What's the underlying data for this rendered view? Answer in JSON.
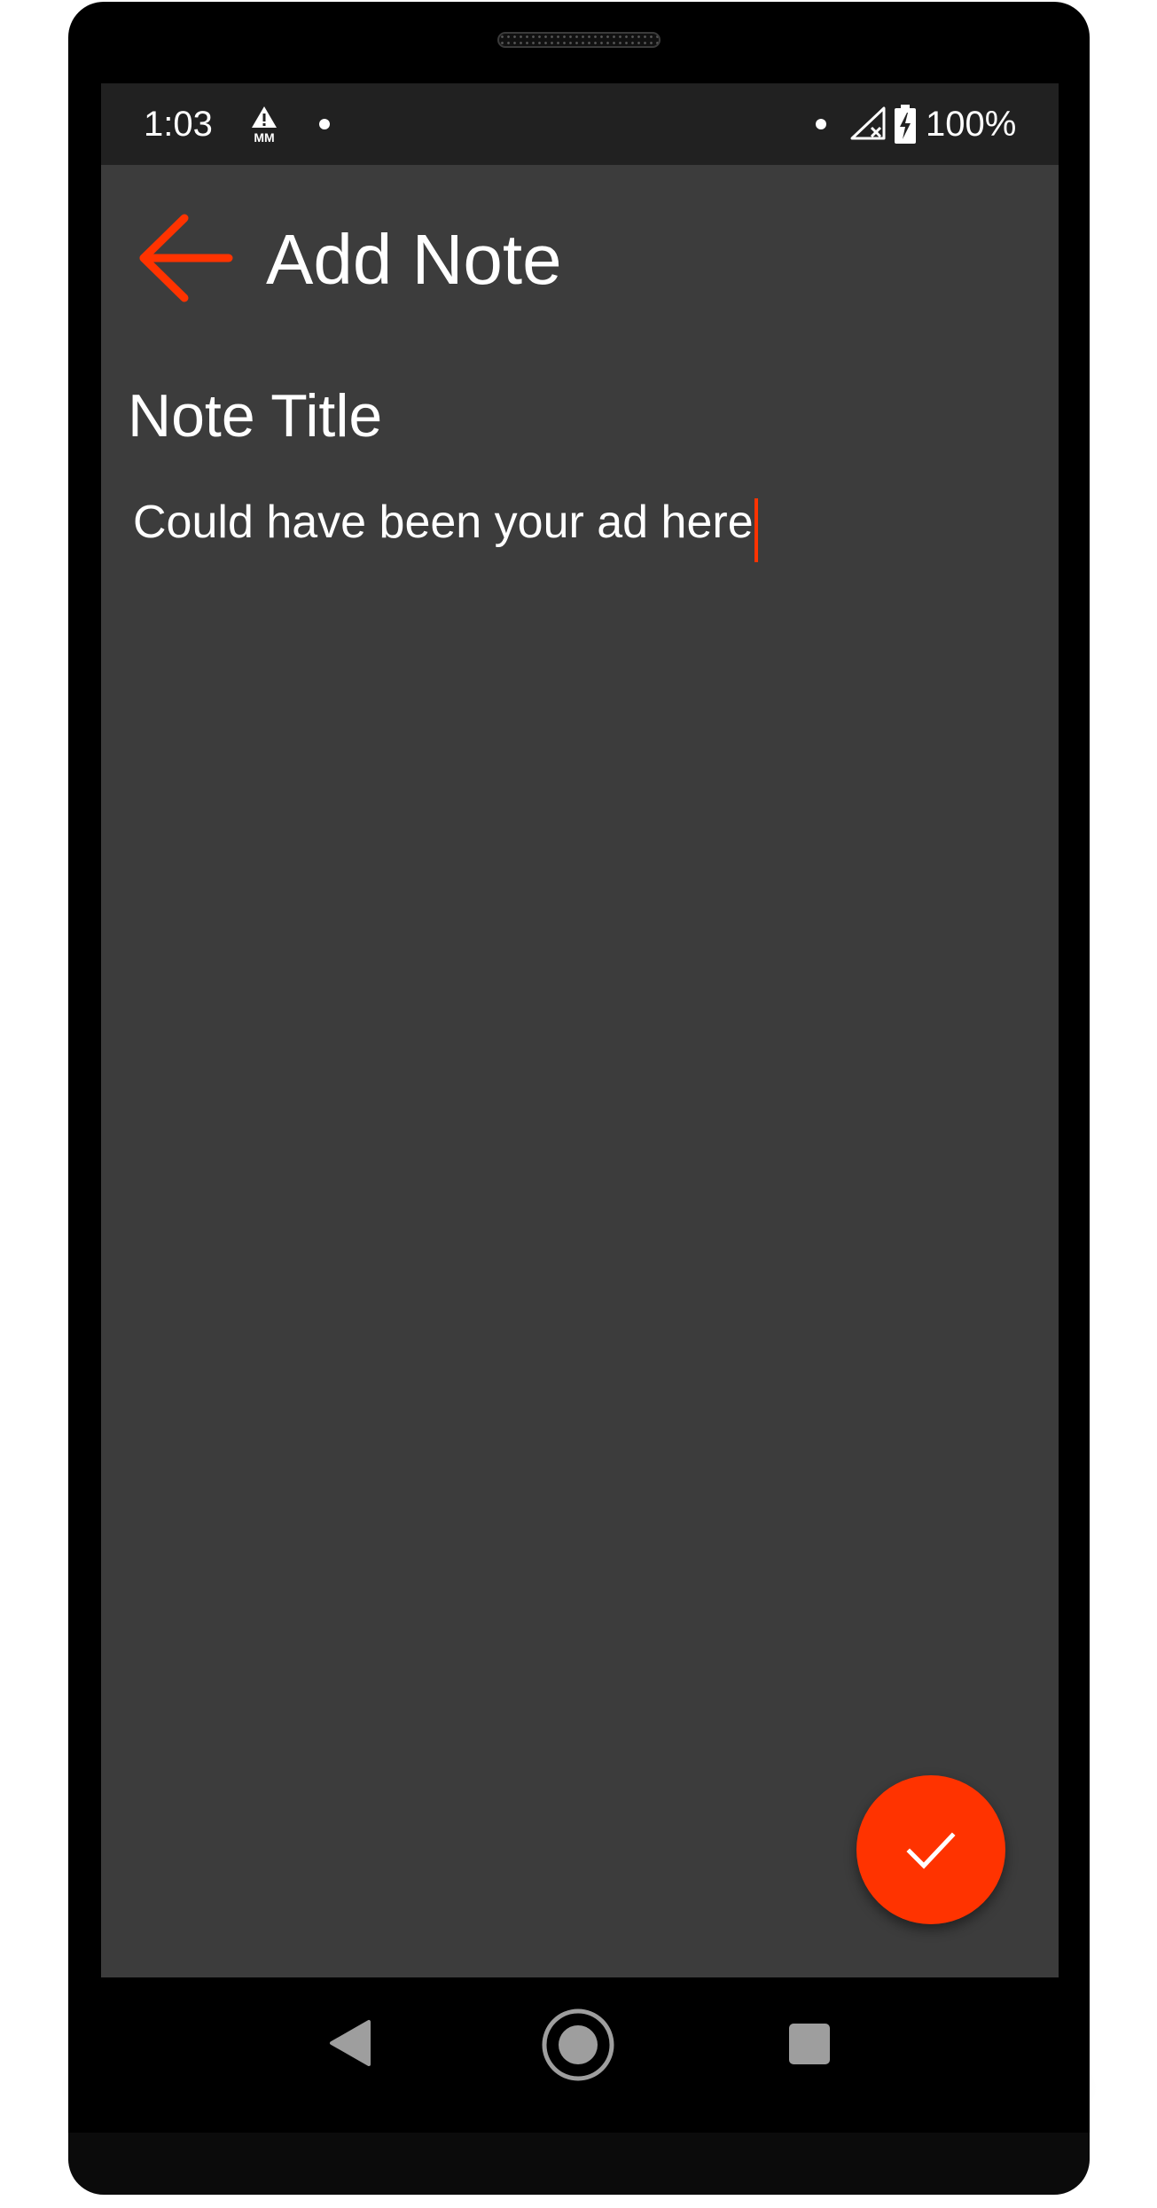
{
  "status_bar": {
    "time": "1:03",
    "battery_text": "100%",
    "icons": [
      "warning-mm-icon",
      "notification-dot-icon",
      "notification-dot-icon",
      "signal-off-icon",
      "battery-charging-icon"
    ]
  },
  "app_bar": {
    "title": "Add Note",
    "back_icon": "arrow-back-icon"
  },
  "note": {
    "title_placeholder": "Note Title",
    "title_value": "",
    "body_value": "Could have been your ad here"
  },
  "fab": {
    "icon": "check-icon"
  },
  "navigation_bar": {
    "icons": [
      "nav-back-icon",
      "nav-home-icon",
      "nav-recents-icon"
    ]
  },
  "colors": {
    "accent": "#ff3300",
    "screen_background": "#3c3c3c",
    "status_bar_background": "#212121",
    "text": "#ffffff"
  }
}
